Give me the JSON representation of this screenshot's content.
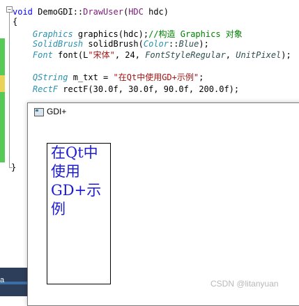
{
  "editor": {
    "lines": [
      {
        "parts": [
          {
            "t": "void ",
            "c": "kw"
          },
          {
            "t": "DemoGDI::",
            "c": "id"
          },
          {
            "t": "DrawUser",
            "c": "fn"
          },
          {
            "t": "(",
            "c": "id"
          },
          {
            "t": "HDC",
            "c": "fn"
          },
          {
            "t": " hdc)",
            "c": "id"
          }
        ]
      },
      {
        "parts": [
          {
            "t": "{",
            "c": "id"
          }
        ]
      },
      {
        "parts": [
          {
            "t": "    ",
            "c": "id"
          },
          {
            "t": "Graphics",
            "c": "ty"
          },
          {
            "t": " graphics(hdc);",
            "c": "id"
          },
          {
            "t": "//构造 Graphics 对象",
            "c": "cm"
          }
        ]
      },
      {
        "parts": [
          {
            "t": "    ",
            "c": "id"
          },
          {
            "t": "SolidBrush",
            "c": "ty"
          },
          {
            "t": " solidBrush(",
            "c": "id"
          },
          {
            "t": "Color",
            "c": "ty"
          },
          {
            "t": "::",
            "c": "id"
          },
          {
            "t": "Blue",
            "c": "en"
          },
          {
            "t": ");",
            "c": "id"
          }
        ]
      },
      {
        "parts": [
          {
            "t": "    ",
            "c": "id"
          },
          {
            "t": "Font",
            "c": "ty"
          },
          {
            "t": " font(L",
            "c": "id"
          },
          {
            "t": "\"宋体\"",
            "c": "str"
          },
          {
            "t": ", 24, ",
            "c": "id"
          },
          {
            "t": "FontStyleRegular",
            "c": "en"
          },
          {
            "t": ", ",
            "c": "id"
          },
          {
            "t": "UnitPixel",
            "c": "en"
          },
          {
            "t": ");",
            "c": "id"
          }
        ]
      },
      {
        "parts": [
          {
            "t": "",
            "c": "id"
          }
        ]
      },
      {
        "parts": [
          {
            "t": "    ",
            "c": "id"
          },
          {
            "t": "QString",
            "c": "ty"
          },
          {
            "t": " m_txt = ",
            "c": "id"
          },
          {
            "t": "\"在Qt中使用GD+示例\"",
            "c": "str"
          },
          {
            "t": ";",
            "c": "id"
          }
        ]
      },
      {
        "parts": [
          {
            "t": "    ",
            "c": "id"
          },
          {
            "t": "RectF",
            "c": "ty"
          },
          {
            "t": " rectF(30.0f, 30.0f, 90.0f, 200.0f);",
            "c": "id"
          }
        ]
      }
    ],
    "closing_brace": "}",
    "fold_glyph": "−"
  },
  "taskbar": {
    "label": "a"
  },
  "gdi_window": {
    "title": "GDI+",
    "drawn_text": "在Qt中使用GD+示例",
    "text_color": "#1c1cd6"
  },
  "watermark": "CSDN @litanyuan"
}
